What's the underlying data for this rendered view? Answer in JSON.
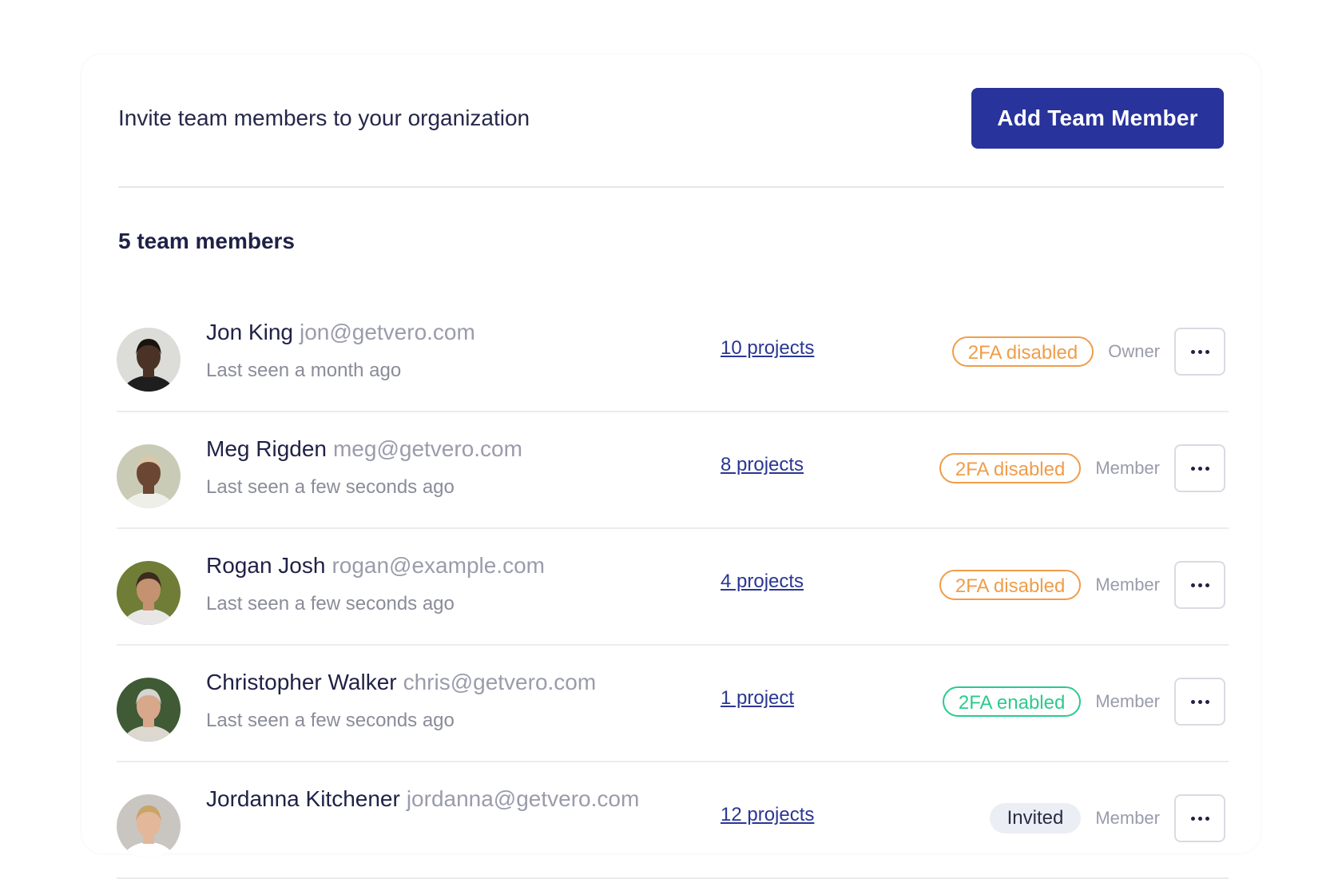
{
  "header": {
    "text": "Invite team members to your organization",
    "add_button_label": "Add Team Member"
  },
  "team": {
    "count_label": "5 team members",
    "members": [
      {
        "name": "Jon King",
        "email": "jon@getvero.com",
        "last_seen": "Last seen a month ago",
        "projects": "10 projects",
        "status": "2FA disabled",
        "status_type": "disabled",
        "role": "Owner",
        "avatar_skin": "#4a3226",
        "avatar_bg": "#dcdcd8",
        "avatar_hair": "#1a1410",
        "avatar_shirt": "#1e1e1e"
      },
      {
        "name": "Meg Rigden",
        "email": "meg@getvero.com",
        "last_seen": "Last seen a few seconds ago",
        "projects": "8 projects",
        "status": "2FA disabled",
        "status_type": "disabled",
        "role": "Member",
        "avatar_skin": "#6b4632",
        "avatar_bg": "#c9cbb6",
        "avatar_hair": "#d8c7a8",
        "avatar_shirt": "#efefe9"
      },
      {
        "name": "Rogan Josh",
        "email": "rogan@example.com",
        "last_seen": "Last seen a few seconds ago",
        "projects": "4 projects",
        "status": "2FA disabled",
        "status_type": "disabled",
        "role": "Member",
        "avatar_skin": "#c59271",
        "avatar_bg": "#6f7d36",
        "avatar_hair": "#3b2a1f",
        "avatar_shirt": "#e9e7e6"
      },
      {
        "name": "Christopher Walker",
        "email": "chris@getvero.com",
        "last_seen": "Last seen a few seconds ago",
        "projects": "1 project",
        "status": "2FA enabled",
        "status_type": "enabled",
        "role": "Member",
        "avatar_skin": "#d7a88c",
        "avatar_bg": "#3f5a35",
        "avatar_hair": "#d6d4d0",
        "avatar_shirt": "#ddd8cf"
      },
      {
        "name": "Jordanna Kitchener",
        "email": "jordanna@getvero.com",
        "last_seen": "",
        "projects": "12 projects",
        "status": "Invited",
        "status_type": "invited",
        "role": "Member",
        "avatar_skin": "#e2b79a",
        "avatar_bg": "#c9c6c2",
        "avatar_hair": "#c9a466",
        "avatar_shirt": "#ffffff"
      }
    ]
  },
  "colors": {
    "primary": "#28339b",
    "badge_disabled": "#ef9d4a",
    "badge_enabled": "#2bcb8e",
    "badge_invited_bg": "#eceef5"
  }
}
